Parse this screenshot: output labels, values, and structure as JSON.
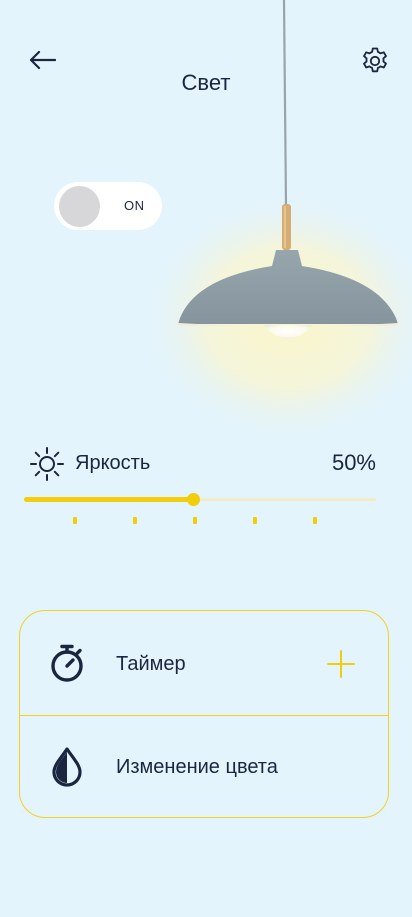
{
  "header": {
    "title": "Свет",
    "back_icon": "arrow-left-icon",
    "settings_icon": "gear-icon"
  },
  "power_toggle": {
    "label": "ON",
    "state": "on"
  },
  "brightness": {
    "icon": "sun-icon",
    "label": "Яркость",
    "value_text": "50%",
    "value_fraction": 0.48,
    "tick_count": 5
  },
  "options": [
    {
      "label": "Таймер",
      "icon": "stopwatch-icon",
      "action_icon": "plus-icon"
    },
    {
      "label": "Изменение цвета",
      "icon": "drop-icon"
    }
  ],
  "colors": {
    "background": "#e3f4fc",
    "accent": "#f2cd0a",
    "text": "#1b2540",
    "lamp_shade": "#8f9da5"
  }
}
